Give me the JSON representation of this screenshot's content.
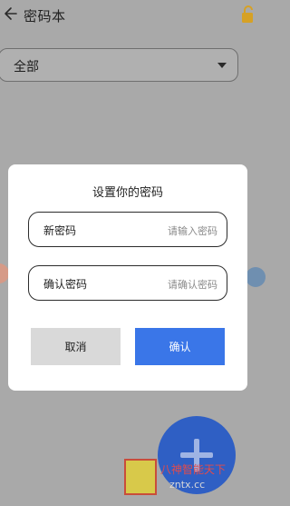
{
  "header": {
    "title": "密码本",
    "back_icon": "arrow-left-icon",
    "lock_icon": "lock-icon"
  },
  "filter": {
    "selected": "全部",
    "caret_icon": "caret-down-icon"
  },
  "dialog": {
    "title": "设置你的密码",
    "new_password": {
      "label": "新密码",
      "placeholder": "请输入密码"
    },
    "confirm_password": {
      "label": "确认密码",
      "placeholder": "请确认密码"
    },
    "cancel": "取消",
    "ok": "确认"
  },
  "fab": {
    "icon": "plus-icon"
  },
  "watermark": {
    "line1": "八神智能天下",
    "line2": "zntx.cc"
  },
  "colors": {
    "primary": "#3a76e8",
    "fab": "#2f5fc4",
    "scrim": "#a9a9a9"
  }
}
